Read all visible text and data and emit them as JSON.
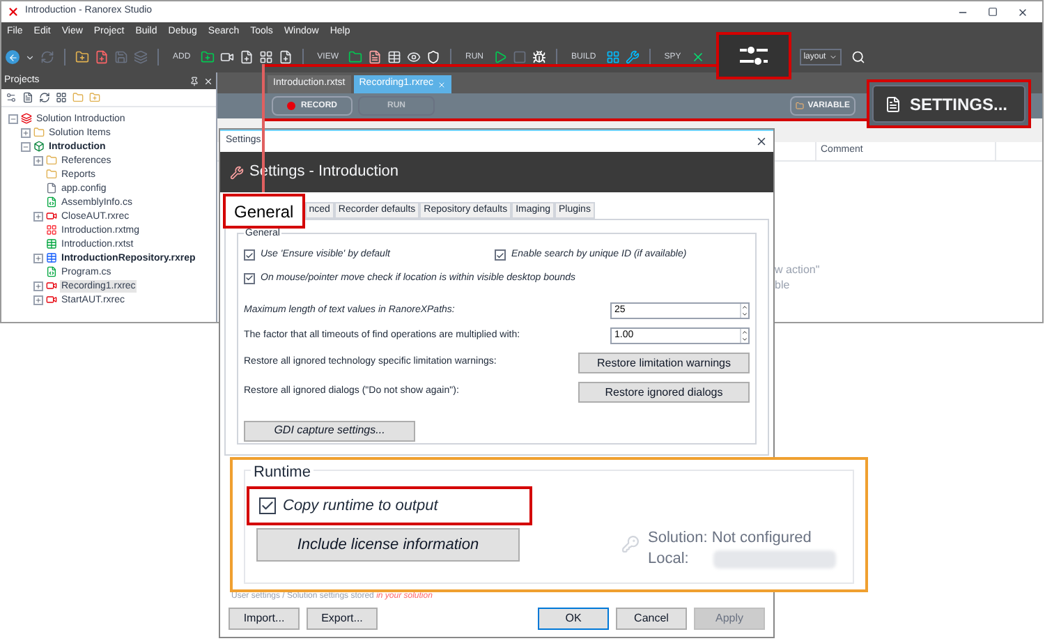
{
  "window": {
    "title": "Introduction - Ranorex Studio"
  },
  "menu": [
    "File",
    "Edit",
    "View",
    "Project",
    "Build",
    "Debug",
    "Search",
    "Tools",
    "Window",
    "Help"
  ],
  "toolbar": {
    "groups": [
      "ADD",
      "VIEW",
      "RUN",
      "BUILD",
      "SPY"
    ],
    "layout_dropdown": "layout"
  },
  "settings_callout": {
    "label": "SETTINGS..."
  },
  "projects": {
    "title": "Projects",
    "tree": [
      {
        "label": "Solution Introduction",
        "kind": "solution",
        "expanded": true,
        "bold": false,
        "selected": false,
        "children": [
          {
            "label": "Solution Items",
            "kind": "folder",
            "expanded": false,
            "bold": false,
            "selected": false
          },
          {
            "label": "Introduction",
            "kind": "project",
            "expanded": true,
            "bold": true,
            "selected": false,
            "children": [
              {
                "label": "References",
                "kind": "folder",
                "expanded": false,
                "bold": false,
                "selected": false
              },
              {
                "label": "Reports",
                "kind": "folder",
                "bold": false,
                "selected": false
              },
              {
                "label": "app.config",
                "kind": "file",
                "bold": false,
                "selected": false
              },
              {
                "label": "AssemblyInfo.cs",
                "kind": "code",
                "bold": false,
                "selected": false
              },
              {
                "label": "CloseAUT.rxrec",
                "kind": "recording",
                "expanded": false,
                "bold": false,
                "selected": false
              },
              {
                "label": "Introduction.rxtmg",
                "kind": "module",
                "bold": false,
                "selected": false
              },
              {
                "label": "Introduction.rxtst",
                "kind": "test",
                "bold": false,
                "selected": false
              },
              {
                "label": "IntroductionRepository.rxrep",
                "kind": "repository",
                "expanded": false,
                "bold": true,
                "selected": false
              },
              {
                "label": "Program.cs",
                "kind": "code",
                "bold": false,
                "selected": false
              },
              {
                "label": "Recording1.rxrec",
                "kind": "recording",
                "expanded": false,
                "bold": false,
                "selected": true
              },
              {
                "label": "StartAUT.rxrec",
                "kind": "recording",
                "expanded": false,
                "bold": false,
                "selected": false
              }
            ]
          }
        ]
      }
    ]
  },
  "editor": {
    "tabs": [
      {
        "label": "Introduction.rxtst",
        "selected": false
      },
      {
        "label": "Recording1.rxrec",
        "selected": true
      }
    ],
    "record": "RECORD",
    "run": {
      "label": "RUN",
      "disabled": true
    },
    "variables": "VARIABLE",
    "columns": [
      "Comment"
    ],
    "hint_lines": [
      "w action\"",
      "ble"
    ]
  },
  "dialog": {
    "title": "Settings",
    "header": "Settings - Introduction",
    "tabs": [
      {
        "label": "General",
        "selected": true
      },
      {
        "label": "nced",
        "selected": false
      },
      {
        "label": "Recorder defaults",
        "selected": false
      },
      {
        "label": "Repository defaults",
        "selected": false
      },
      {
        "label": "Imaging",
        "selected": false
      },
      {
        "label": "Plugins",
        "selected": false
      }
    ],
    "general": {
      "title": "General",
      "checks": [
        {
          "label": "Use 'Ensure visible' by default",
          "checked": true
        },
        {
          "label": "Enable search by unique ID (if available)",
          "checked": true
        },
        {
          "label": "On mouse/pointer move check if location is within visible desktop bounds",
          "checked": true
        }
      ],
      "fields": [
        {
          "label": "Maximum length of text values in RanoreXPaths:",
          "value": "25",
          "italic": true
        },
        {
          "label": "The factor that all timeouts of find operations are multiplied with:",
          "value": "1.00",
          "italic": false
        }
      ],
      "restore_rows": [
        {
          "label": "Restore all ignored technology specific limitation warnings:",
          "button": "Restore limitation warnings"
        },
        {
          "label": "Restore all ignored dialogs (\"Do not show again\"):",
          "button": "Restore ignored dialogs"
        }
      ],
      "gdi_button": "GDI capture settings..."
    },
    "runtime": {
      "title": "Runtime",
      "copy": {
        "label": "Copy runtime to output",
        "checked": true
      },
      "license_button": "Include license information",
      "solution_label": "Solution:",
      "solution_value": "Not configured",
      "local_label": "Local:"
    },
    "storage_note": {
      "text": "User settings / Solution settings stored",
      "link": "in your solution"
    },
    "buttons_left": [
      {
        "label": "Import...",
        "default": false,
        "disabled": false
      },
      {
        "label": "Export...",
        "default": false,
        "disabled": false
      }
    ],
    "buttons_right": [
      {
        "label": "OK",
        "default": true,
        "disabled": false
      },
      {
        "label": "Cancel",
        "default": false,
        "disabled": false
      },
      {
        "label": "Apply",
        "default": false,
        "disabled": true
      }
    ]
  }
}
